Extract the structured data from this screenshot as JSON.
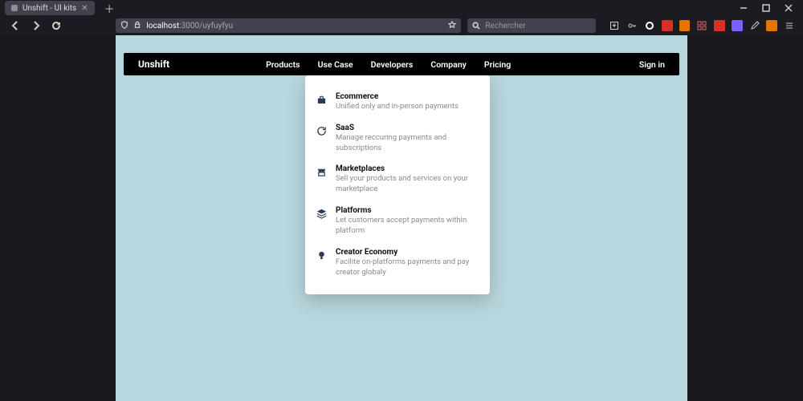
{
  "browser": {
    "tab_title": "Unshift - UI kits",
    "url_host": "localhost",
    "url_path": ":3000/uyfuyfyu",
    "search_placeholder": "Rechercher"
  },
  "header": {
    "brand": "Unshift",
    "nav": [
      "Products",
      "Use Case",
      "Developers",
      "Company",
      "Pricing"
    ],
    "signin": "Sign in"
  },
  "dropdown": {
    "items": [
      {
        "title": "Ecommerce",
        "desc": "Unified only and in-person payments"
      },
      {
        "title": "SaaS",
        "desc": "Manage reccuring payments and subscriptions"
      },
      {
        "title": "Marketplaces",
        "desc": "Sell your products and services on your marketplace"
      },
      {
        "title": "Platforms",
        "desc": "Let customers accept payments within platform"
      },
      {
        "title": "Creator Economy",
        "desc": "Facilite on-platforms payments and pay creator globaly"
      }
    ]
  }
}
